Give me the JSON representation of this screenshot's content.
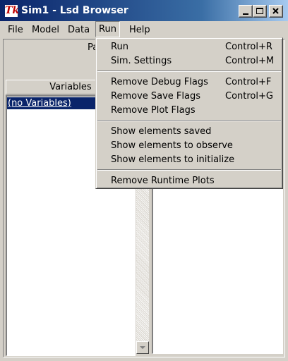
{
  "window": {
    "title": "Sim1 - Lsd Browser",
    "icon_text": "Tk"
  },
  "menubar": {
    "items": [
      {
        "label": "File"
      },
      {
        "label": "Model"
      },
      {
        "label": "Data"
      },
      {
        "label": "Run",
        "active": true
      },
      {
        "label": "Help"
      }
    ]
  },
  "main": {
    "param_label_partial": "Pa",
    "variables_header": "Variables",
    "variables_list": [
      {
        "label": "(no Variables)",
        "selected": true
      }
    ]
  },
  "run_menu": {
    "items": [
      {
        "label": "Run",
        "shortcut": "Control+R"
      },
      {
        "label": "Sim. Settings",
        "shortcut": "Control+M"
      },
      {
        "label": "Remove Debug Flags",
        "shortcut": "Control+F"
      },
      {
        "label": "Remove Save Flags",
        "shortcut": "Control+G"
      },
      {
        "label": "Remove Plot Flags",
        "shortcut": ""
      },
      {
        "label": "Show elements saved",
        "shortcut": ""
      },
      {
        "label": "Show elements to observe",
        "shortcut": ""
      },
      {
        "label": "Show elements to initialize",
        "shortcut": ""
      },
      {
        "label": "Remove Runtime Plots",
        "shortcut": ""
      }
    ]
  },
  "colors": {
    "titlebar_start": "#0a246a",
    "titlebar_end": "#a6caf0",
    "face": "#d4d0c8",
    "selection": "#0a246a"
  }
}
